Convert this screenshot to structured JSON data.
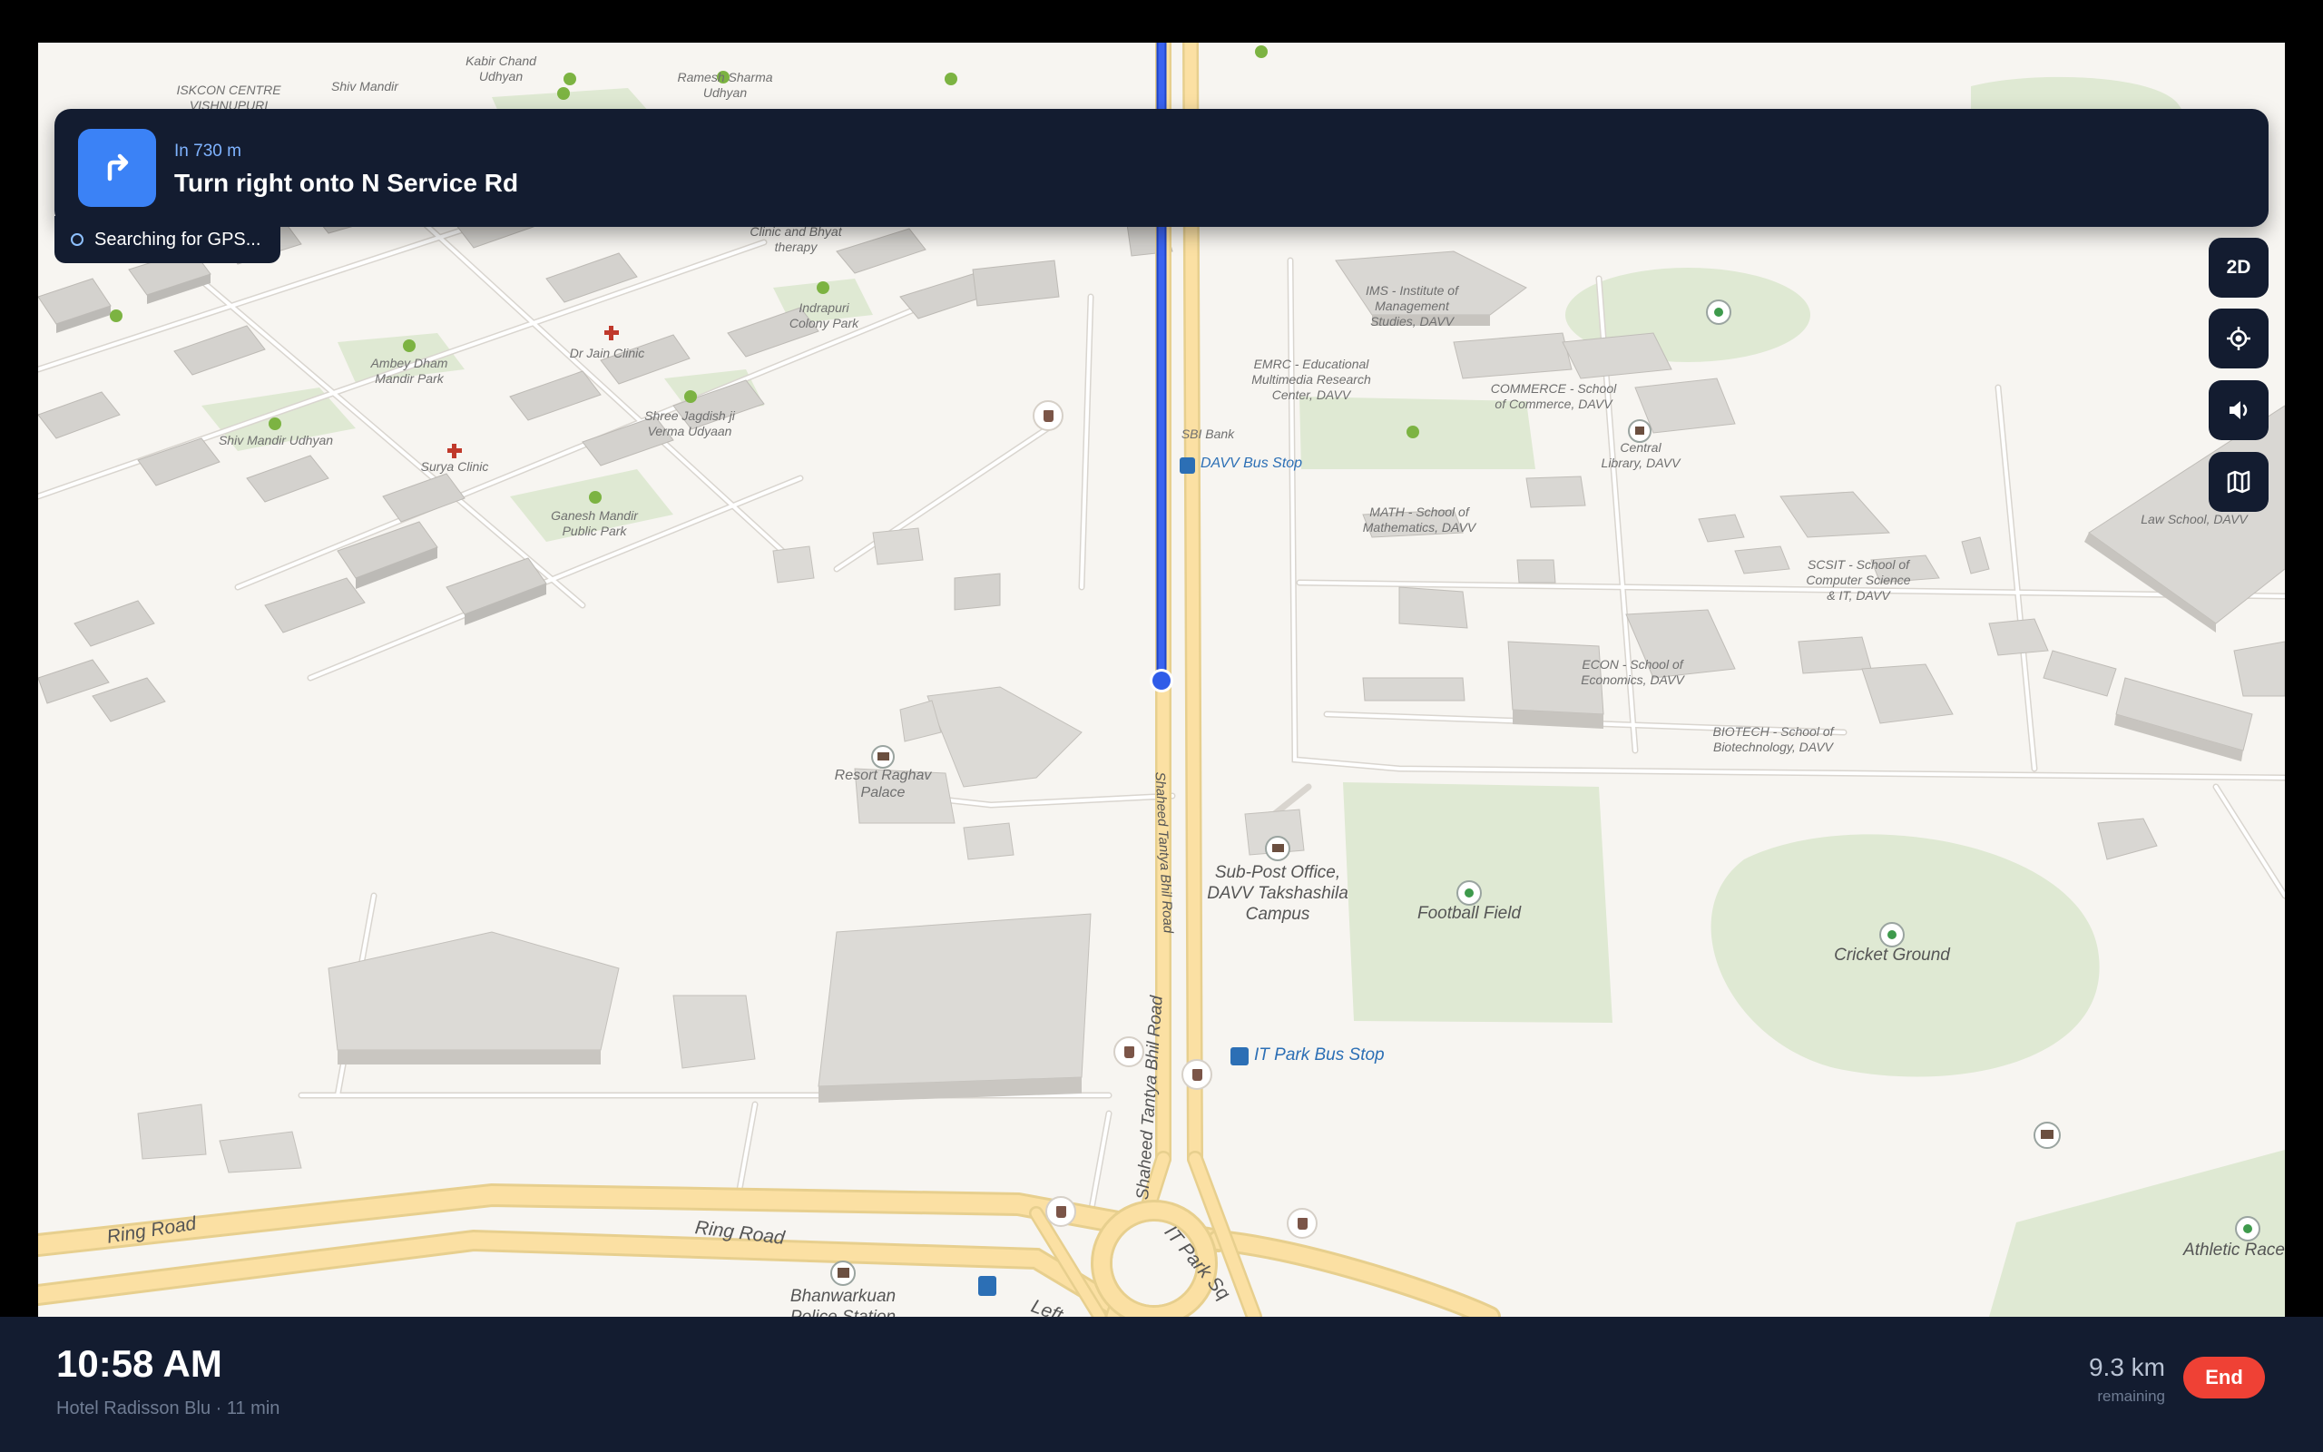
{
  "navigation": {
    "distance": "In 730 m",
    "instruction": "Turn right onto N Service Rd",
    "turn_icon": "turn-right-icon"
  },
  "gps_status": "Searching for GPS...",
  "controls": {
    "view_mode": "2D",
    "recenter_icon": "crosshair-icon",
    "sound_icon": "speaker-icon",
    "layers_icon": "map-icon"
  },
  "footer": {
    "eta": "10:58 AM",
    "destination": "Hotel Radisson Blu · 11 min",
    "distance": "9.3 km",
    "distance_caption": "remaining",
    "end_label": "End"
  },
  "map": {
    "labels": {
      "iskcon": "ISKCON CENTRE\nVISHNUPURI",
      "shiv_mandir_top": "Shiv Mandir",
      "kabir": "Kabir Chand\nUdhyan",
      "ramesh": "Ramesh Sharma\nUdhyan",
      "clinic_bhyat": "Clinic and Bhyat\ntherapy",
      "indrapuri": "Indrapuri\nColony Park",
      "ambey": "Ambey Dham\nMandir Park",
      "dr_jain": "Dr Jain Clinic",
      "shree_jagdish": "Shree Jagdish ji\nVerma Udyaan",
      "shiv_mandir_udhyan": "Shiv Mandir Udhyan",
      "surya": "Surya Clinic",
      "ganesh": "Ganesh Mandir\nPublic Park",
      "ims": "IMS - Institute of\nManagement\nStudies, DAVV",
      "emrc": "EMRC - Educational\nMultimedia Research\nCenter, DAVV",
      "commerce": "COMMERCE - School\nof Commerce, DAVV",
      "central_library": "Central\nLibrary, DAVV",
      "sbi": "SBI Bank",
      "math": "MATH - School of\nMathematics, DAVV",
      "scsit": "SCSIT - School of\nComputer Science\n& IT, DAVV",
      "law": "Law School, DAVV",
      "econ": "ECON - School of\nEconomics, DAVV",
      "biotech": "BIOTECH - School of\nBiotechnology, DAVV",
      "resort": "Resort Raghav\nPalace",
      "post_office": "Sub-Post Office,\nDAVV Takshashila\nCampus",
      "football": "Football Field",
      "cricket": "Cricket Ground",
      "athletic": "Athletic Race",
      "bhanwarkuan": "Bhanwarkuan\nPolice Station"
    },
    "roads": {
      "shaheed_upper": "Shaheed Tantya Bhil Road",
      "shaheed_lower": "Shaheed Tantya Bhil Road",
      "ring_left": "Ring Road",
      "ring_mid": "Ring Road",
      "it_park": "IT Park Sq",
      "left": "Left"
    },
    "bus_stops": {
      "davv": "DAVV Bus Stop",
      "it_park": "IT Park Bus Stop"
    }
  }
}
